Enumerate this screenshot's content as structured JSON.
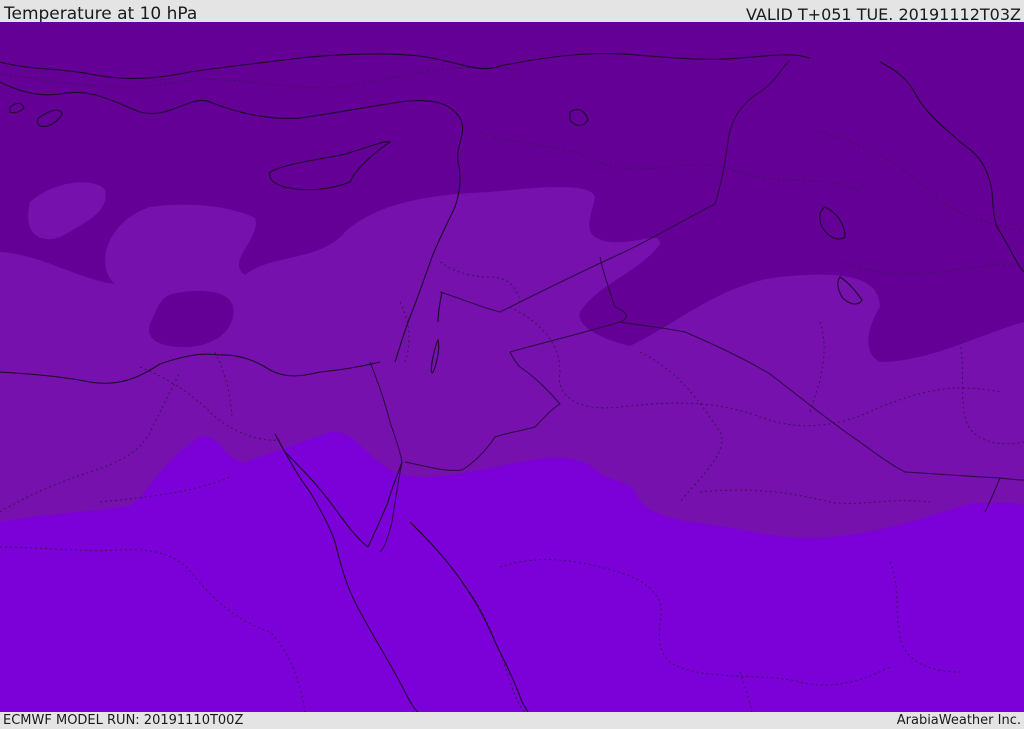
{
  "header": {
    "title": "Temperature at 10 hPa",
    "valid_time": "VALID T+051 TUE. 20191112T03Z"
  },
  "footer": {
    "model_run": "ECMWF MODEL RUN: 20191110T00Z",
    "credit": "ArabiaWeather Inc."
  },
  "colors": {
    "frame_bg": "#e4e4e4",
    "band_coldest": "#650097",
    "band_middle": "#7611ad",
    "band_warmest": "#7c00d8",
    "band_faint": "#8a3be8",
    "coastline": "#1c0a2a",
    "border": "#2a0a40"
  }
}
